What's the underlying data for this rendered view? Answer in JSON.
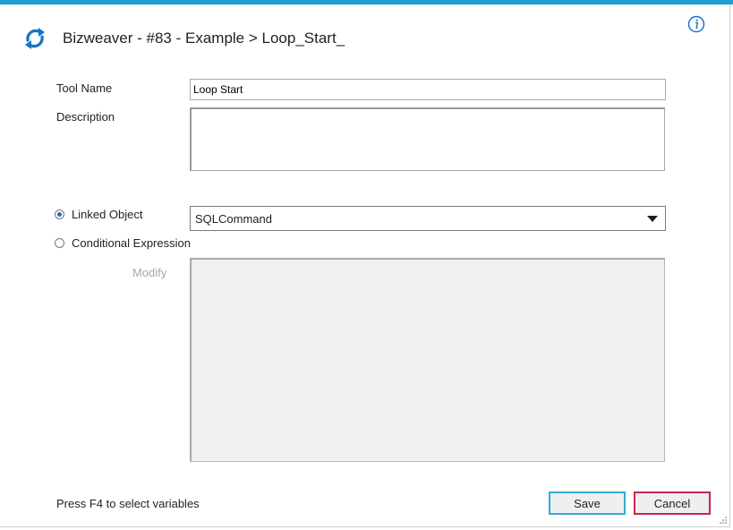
{
  "window": {
    "title": "Bizweaver - #83 - Example > Loop_Start_",
    "accent_color": "#1ba1d2",
    "app_icon": "refresh-arrows-icon",
    "info_icon": "info-icon"
  },
  "form": {
    "tool_name_label": "Tool Name",
    "tool_name_value": "Loop Start",
    "description_label": "Description",
    "description_value": "",
    "linked_object_label": "Linked Object",
    "linked_object_selected": true,
    "linked_object_value": "SQLCommand",
    "conditional_expression_label": "Conditional Expression",
    "conditional_expression_selected": false,
    "modify_label": "Modify"
  },
  "footer": {
    "hint": "Press F4 to select variables",
    "save_label": "Save",
    "cancel_label": "Cancel",
    "save_color": "#33a9d6",
    "cancel_color": "#c8264f"
  }
}
